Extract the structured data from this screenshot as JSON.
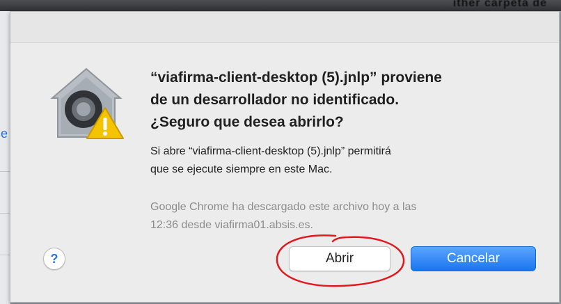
{
  "background": {
    "top_text": "ither carpeta de"
  },
  "dialog": {
    "title_lines": [
      "“viafirma-client-desktop (5).jnlp” proviene",
      "de un desarrollador no identificado.",
      "¿Seguro que desea abrirlo?"
    ],
    "body_lines": [
      "Si abre “viafirma-client-desktop (5).jnlp” permitirá",
      "que se ejecute siempre en este Mac."
    ],
    "info_lines": [
      "Google Chrome ha descargado este archivo hoy a las",
      "12:36 desde viafirma01.absis.es."
    ],
    "help_label": "?",
    "open_label": "Abrir",
    "cancel_label": "Cancelar",
    "icon": "gatekeeper-warning-icon"
  },
  "colors": {
    "primary_button": "#1a75f0",
    "annotation": "#e0191e",
    "warning": "#f5c400"
  }
}
